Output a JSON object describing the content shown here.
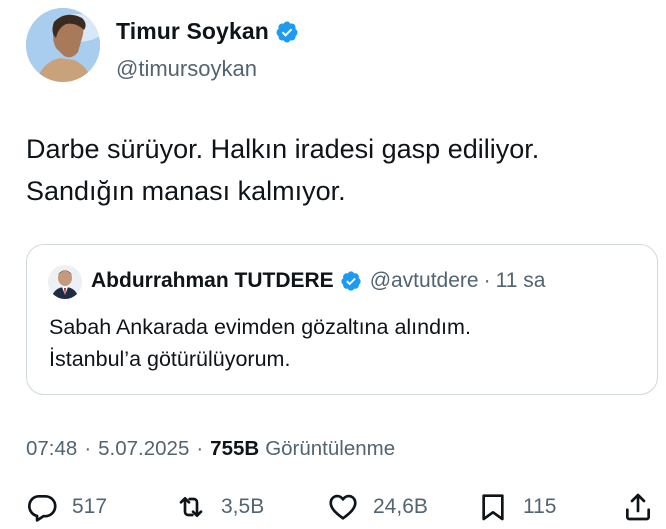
{
  "author": {
    "display_name": "Timur Soykan",
    "handle": "@timursoykan"
  },
  "tweet": {
    "lines": [
      "Darbe sürüyor. Halkın iradesi gasp ediliyor.",
      "Sandığın manası kalmıyor."
    ]
  },
  "quoted": {
    "display_name": "Abdurrahman TUTDERE",
    "handle": "@avtutdere",
    "dot": "·",
    "time": "11 sa",
    "lines": [
      "Sabah Ankarada evimden gözaltına alındım.",
      "İstanbul’a götürülüyorum."
    ]
  },
  "meta": {
    "time": "07:48",
    "sep": "·",
    "date": "5.07.2025",
    "views_count": "755B",
    "views_label": "Görüntülenme"
  },
  "actions": {
    "replies": "517",
    "reposts": "3,5B",
    "likes": "24,6B",
    "bookmarks": "115"
  },
  "colors": {
    "verified": "#1d9bf0",
    "text": "#0f1419",
    "secondary": "#536471",
    "border": "#cfd9de"
  }
}
